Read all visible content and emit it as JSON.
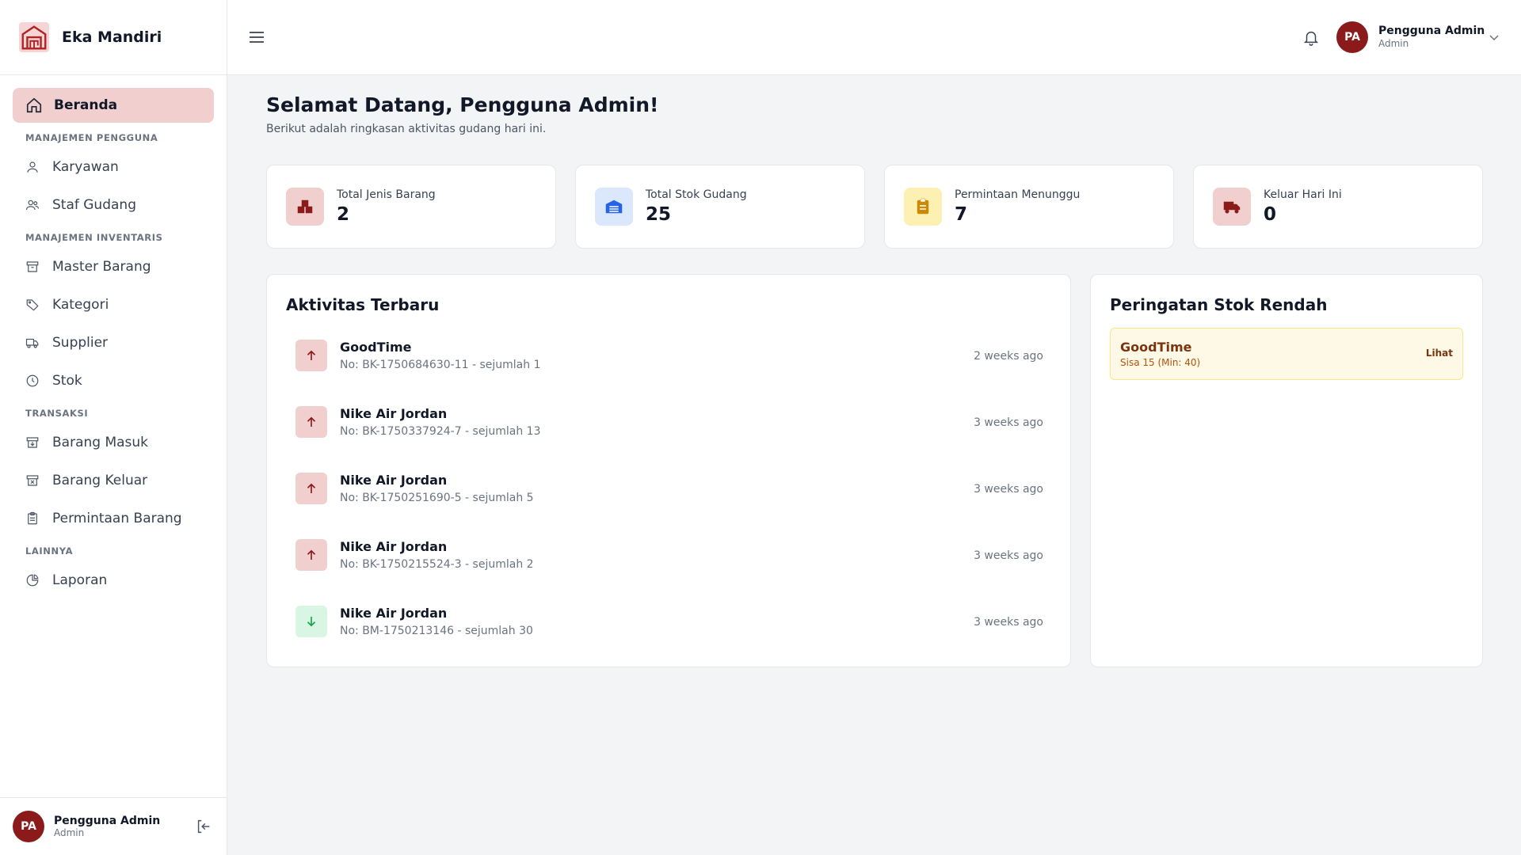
{
  "app": {
    "brand_name": "Eka Mandiri"
  },
  "sidebar": {
    "active": {
      "label": "Beranda",
      "icon": "home-icon"
    },
    "sections": [
      {
        "title": "MANAJEMEN PENGGUNA",
        "items": [
          {
            "label": "Karyawan",
            "icon": "user-icon"
          },
          {
            "label": "Staf Gudang",
            "icon": "users-icon"
          }
        ]
      },
      {
        "title": "MANAJEMEN INVENTARIS",
        "items": [
          {
            "label": "Master Barang",
            "icon": "archive-icon"
          },
          {
            "label": "Kategori",
            "icon": "tag-icon"
          },
          {
            "label": "Supplier",
            "icon": "truck-icon"
          },
          {
            "label": "Stok",
            "icon": "clock-icon"
          }
        ]
      },
      {
        "title": "TRANSAKSI",
        "items": [
          {
            "label": "Barang Masuk",
            "icon": "box-in-icon"
          },
          {
            "label": "Barang Keluar",
            "icon": "box-out-icon"
          },
          {
            "label": "Permintaan Barang",
            "icon": "clipboard-icon"
          }
        ]
      },
      {
        "title": "LAINNYA",
        "items": [
          {
            "label": "Laporan",
            "icon": "pie-chart-icon"
          }
        ]
      }
    ],
    "footer": {
      "initials": "PA",
      "name": "Pengguna Admin",
      "role": "Admin"
    }
  },
  "header": {
    "initials": "PA",
    "user_name": "Pengguna Admin",
    "user_role": "Admin"
  },
  "main": {
    "welcome": "Selamat Datang, Pengguna Admin!",
    "subtitle": "Berikut adalah ringkasan aktivitas gudang hari ini.",
    "stats": [
      {
        "label": "Total Jenis Barang",
        "value": "2",
        "icon": "boxes-icon",
        "bg": "#f2cfcf",
        "fg": "#8b1a1a"
      },
      {
        "label": "Total Stok Gudang",
        "value": "25",
        "icon": "warehouse-icon",
        "bg": "#dbe7fb",
        "fg": "#2563eb"
      },
      {
        "label": "Permintaan Menunggu",
        "value": "7",
        "icon": "clipboard-icon",
        "bg": "#fdf0b3",
        "fg": "#ca8a04"
      },
      {
        "label": "Keluar Hari Ini",
        "value": "0",
        "icon": "truck-icon",
        "bg": "#f2cfcf",
        "fg": "#8b1a1a"
      }
    ],
    "activity": {
      "title": "Aktivitas Terbaru",
      "items": [
        {
          "title": "GoodTime",
          "sub": "No: BK-1750684630-11 - sejumlah 1",
          "time": "2 weeks ago",
          "direction": "up"
        },
        {
          "title": "Nike Air Jordan",
          "sub": "No: BK-1750337924-7 - sejumlah 13",
          "time": "3 weeks ago",
          "direction": "up"
        },
        {
          "title": "Nike Air Jordan",
          "sub": "No: BK-1750251690-5 - sejumlah 5",
          "time": "3 weeks ago",
          "direction": "up"
        },
        {
          "title": "Nike Air Jordan",
          "sub": "No: BK-1750215524-3 - sejumlah 2",
          "time": "3 weeks ago",
          "direction": "up"
        },
        {
          "title": "Nike Air Jordan",
          "sub": "No: BM-1750213146 - sejumlah 30",
          "time": "3 weeks ago",
          "direction": "down"
        }
      ]
    },
    "low_stock": {
      "title": "Peringatan Stok Rendah",
      "items": [
        {
          "name": "GoodTime",
          "detail": "Sisa 15 (Min: 40)",
          "link": "Lihat"
        }
      ]
    }
  },
  "colors": {
    "accent": "#8b1a1a",
    "active_bg": "#f2cfcf",
    "up_bg": "#f2cfcf",
    "up_fg": "#8b1a1a",
    "down_bg": "#d9f5e3",
    "down_fg": "#16a34a"
  }
}
